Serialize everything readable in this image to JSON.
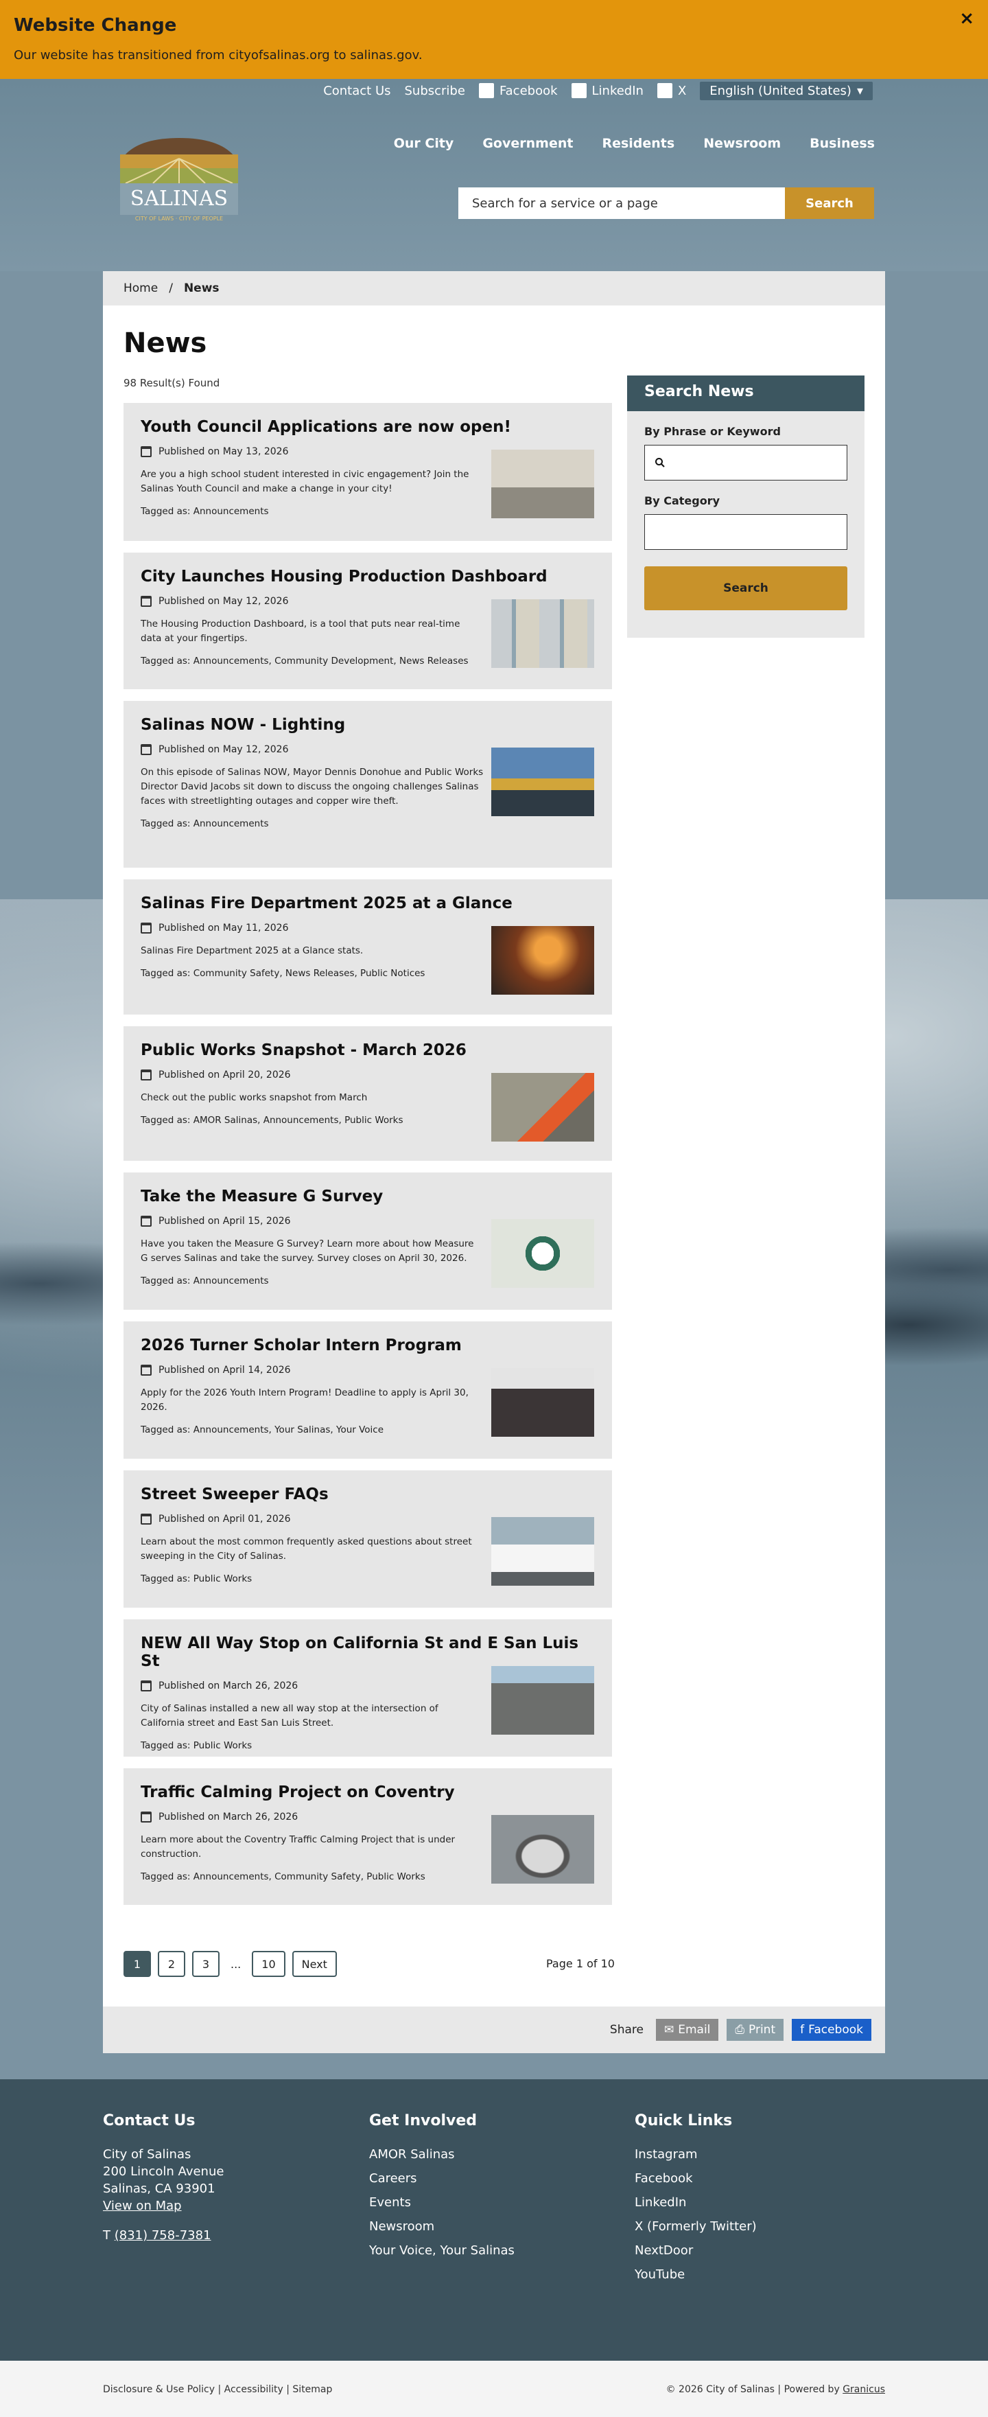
{
  "alert": {
    "title": "Website Change",
    "message": "Our website has transitioned from cityofsalinas.org to salinas.gov.",
    "close": "×"
  },
  "utility": {
    "contact": "Contact Us",
    "subscribe": "Subscribe",
    "facebook": "Facebook",
    "linkedin": "LinkedIn",
    "x": "X",
    "language": "English (United States)"
  },
  "logo": {
    "name": "SALINAS",
    "tagline": "CITY OF LAWS · CITY OF PEOPLE"
  },
  "nav": [
    "Our City",
    "Government",
    "Residents",
    "Newsroom",
    "Business"
  ],
  "search": {
    "placeholder": "Search for a service or a page",
    "button": "Search"
  },
  "breadcrumb": {
    "home": "Home",
    "sep": "/",
    "current": "News"
  },
  "page": {
    "title": "News",
    "count": "98 Result(s) Found"
  },
  "articles": [
    {
      "title": "Youth Council Applications are now open!",
      "date": "Published on May 13, 2026",
      "desc": "Are you a high school student interested in civic engagement? Join the Salinas Youth Council and make a change in your city!",
      "tags": "Tagged as: Announcements",
      "thumb": "#c9c2b6"
    },
    {
      "title": "City Launches Housing Production Dashboard",
      "date": "Published on May 12, 2026",
      "desc": "The Housing Production Dashboard, is a tool that puts near real-time data at your fingertips.",
      "tags": "Tagged as: Announcements, Community Development, News Releases",
      "thumb": "#b7bfc3"
    },
    {
      "title": "Salinas NOW - Lighting",
      "date": "Published on May 12, 2026",
      "desc": "On this episode of Salinas NOW, Mayor Dennis Donohue and Public Works Director David Jacobs sit down to discuss the ongoing challenges Salinas faces with streetlighting outages and copper wire theft.",
      "tags": "Tagged as: Announcements",
      "thumb": "#4f79a6"
    },
    {
      "title": "Salinas Fire Department 2025 at a Glance",
      "date": "Published on May 11, 2026",
      "desc": "Salinas Fire Department 2025 at a Glance stats.",
      "tags": "Tagged as: Community Safety, News Releases, Public Notices",
      "thumb": "#5a3a24"
    },
    {
      "title": "Public Works Snapshot - March 2026",
      "date": "Published on April 20, 2026",
      "desc": "Check out the public works snapshot from March",
      "tags": "Tagged as: AMOR Salinas, Announcements, Public Works",
      "thumb": "#8c8a7e"
    },
    {
      "title": "Take the Measure G Survey",
      "date": "Published on April 15, 2026",
      "desc": "Have you taken the Measure G Survey? Learn more about how Measure G serves Salinas and take the survey. Survey closes on April 30, 2026.",
      "tags": "Tagged as: Announcements",
      "thumb": "#dfe3dc"
    },
    {
      "title": "2026 Turner Scholar Intern Program",
      "date": "Published on April 14, 2026",
      "desc": "Apply for the 2026 Youth Intern Program! Deadline to apply is April 30, 2026.",
      "tags": "Tagged as: Announcements, Your Salinas, Your Voice",
      "thumb": "#6e6a6a"
    },
    {
      "title": "Street Sweeper FAQs",
      "date": "Published on April 01, 2026",
      "desc": "Learn about the most common frequently asked questions about street sweeping in the City of Salinas.",
      "tags": "Tagged as: Public Works",
      "thumb": "#8fa0ab"
    },
    {
      "title": "NEW All Way Stop on California St and E San Luis St",
      "date": "Published on March 26, 2026",
      "desc": "City of Salinas installed a new all way stop at the intersection of California street and East San Luis Street.",
      "tags": "Tagged as: Public Works",
      "thumb": "#7d7f80"
    },
    {
      "title": "Traffic Calming Project on Coventry",
      "date": "Published on March 26, 2026",
      "desc": "Learn more about the Coventry Traffic Calming Project that is under construction.",
      "tags": "Tagged as: Announcements, Community Safety, Public Works",
      "thumb": "#8a8f93"
    }
  ],
  "pager": {
    "pages": [
      "1",
      "2",
      "3"
    ],
    "ellipsis": "...",
    "last": "10",
    "next": "Next",
    "status": "Page 1 of 10"
  },
  "sidebar": {
    "title": "Search News",
    "phrase_label": "By Phrase or Keyword",
    "category_label": "By Category",
    "button": "Search"
  },
  "share": {
    "label": "Share",
    "email": "Email",
    "print": "Print",
    "facebook": "Facebook"
  },
  "footer": {
    "contact": {
      "title": "Contact Us",
      "lines": [
        "City of Salinas",
        "200 Lincoln Avenue",
        "Salinas, CA 93901"
      ],
      "map": "View on Map",
      "phone_prefix": "T",
      "phone": "(831) 758-7381"
    },
    "involved": {
      "title": "Get Involved",
      "links": [
        "AMOR Salinas",
        "Careers",
        "Events",
        "Newsroom",
        "Your Voice, Your Salinas"
      ]
    },
    "quick": {
      "title": "Quick Links",
      "links": [
        "Instagram",
        "Facebook",
        "LinkedIn",
        "X (Formerly Twitter)",
        "NextDoor",
        "YouTube"
      ]
    }
  },
  "legal": {
    "left": "Disclosure & Use Policy | Accessibility | Sitemap",
    "right_prefix": "© 2026 City of Salinas | Powered by",
    "right_link": "Granicus"
  },
  "colors": {
    "alert": "#e3950c",
    "accent": "#c8922a",
    "dark": "#3c5660",
    "footer": "#3c525d"
  }
}
